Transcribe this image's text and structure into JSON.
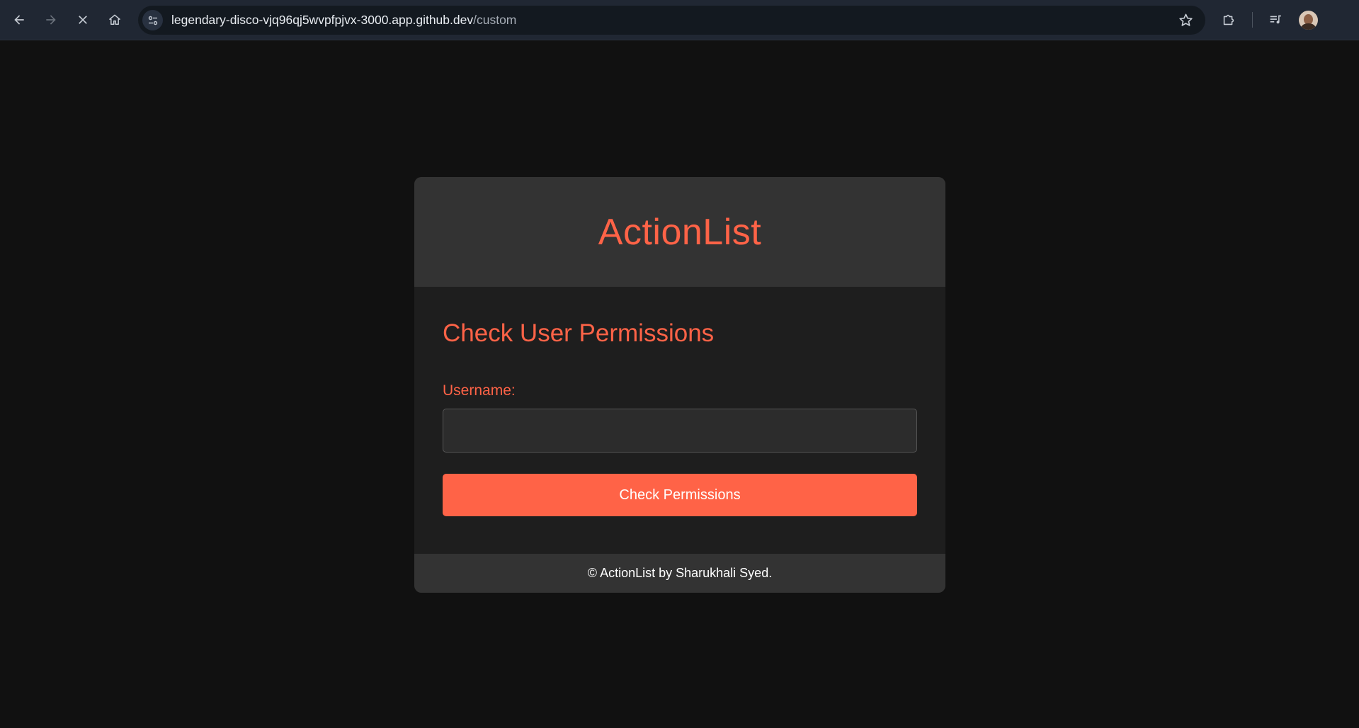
{
  "browser": {
    "url_host": "legendary-disco-vjq96qj5wvpfpjvx-3000.app.github.dev",
    "url_path": "/custom",
    "icons": {
      "back": "arrow-left-icon",
      "forward": "arrow-right-icon",
      "stop": "close-icon",
      "home": "home-icon",
      "site_info": "tune-icon",
      "bookmark": "star-icon",
      "extensions": "puzzle-icon",
      "media": "queue-music-icon",
      "profile": "avatar"
    }
  },
  "app": {
    "title": "ActionList",
    "section_title": "Check User Permissions",
    "form": {
      "username_label": "Username:",
      "username_value": "",
      "submit_label": "Check Permissions"
    },
    "footer": "© ActionList by Sharukhali Syed."
  },
  "colors": {
    "accent": "#ff6347",
    "page_background": "#111111",
    "card_header": "#333333",
    "card_body": "#1e1e1e"
  }
}
